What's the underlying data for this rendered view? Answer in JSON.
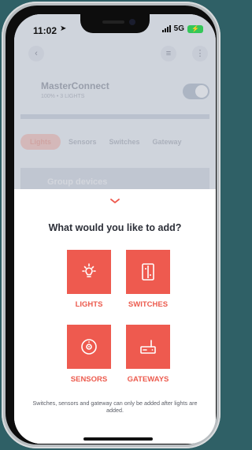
{
  "status_bar": {
    "time": "11:02",
    "network": "5G"
  },
  "app": {
    "name": "MasterConnect",
    "subtitle": "100% • 3 LIGHTS",
    "tabs": [
      {
        "label": "Lights",
        "active": true
      },
      {
        "label": "Sensors",
        "active": false
      },
      {
        "label": "Switches",
        "active": false
      },
      {
        "label": "Gateway",
        "active": false
      }
    ],
    "group_section": "Group devices"
  },
  "sheet": {
    "title": "What would you like to add?",
    "options": [
      {
        "label": "LIGHTS",
        "icon": "light-bulb-icon"
      },
      {
        "label": "SWITCHES",
        "icon": "switch-icon"
      },
      {
        "label": "SENSORS",
        "icon": "sensor-icon"
      },
      {
        "label": "GATEWAYS",
        "icon": "gateway-icon"
      }
    ],
    "note": "Switches, sensors and gateway can only be added after lights are added."
  },
  "colors": {
    "accent": "#ee5a4f",
    "accent_text": "#ec5b4e",
    "battery": "#34c759"
  }
}
